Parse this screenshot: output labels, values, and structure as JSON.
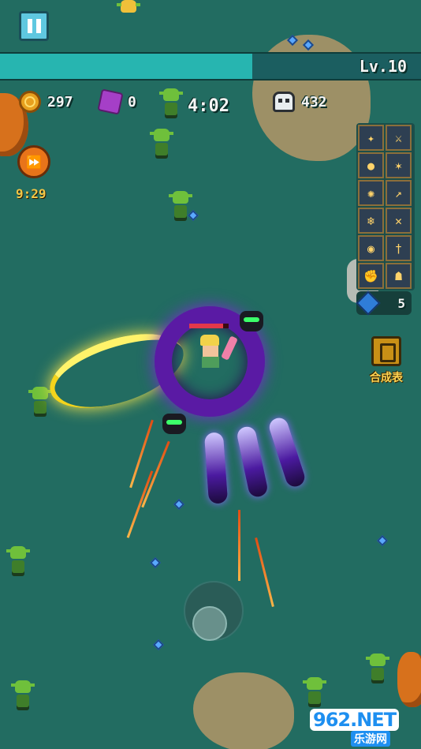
{
  "hud": {
    "level": "Lv.10",
    "xp_fraction": 0.6,
    "coins": "297",
    "puzzle_pieces": "0",
    "timer": "4:02",
    "kills": "432",
    "speed_timer": "9:29"
  },
  "player": {
    "hp_fraction": 0.85
  },
  "skills": {
    "slots": [
      "dragon-skill",
      "sword-skill",
      "flame-orb-skill",
      "spiked-star-skill",
      "magic-circle-skill",
      "spear-skill",
      "ice-shard-skill",
      "needle-skill",
      "orb-skill",
      "wand-skill",
      "gauntlet-skill",
      "black-cat-skill"
    ],
    "gem_count": "5"
  },
  "synthesis": {
    "label": "合成表"
  },
  "watermark": {
    "logo": "962.NET",
    "sub": "乐游网"
  },
  "colors": {
    "ground": "#226c61",
    "xp_fill": "#27b5b0",
    "ring": "#5a1aa4",
    "hp": "#e3384a",
    "gold_text": "#f3c646"
  }
}
